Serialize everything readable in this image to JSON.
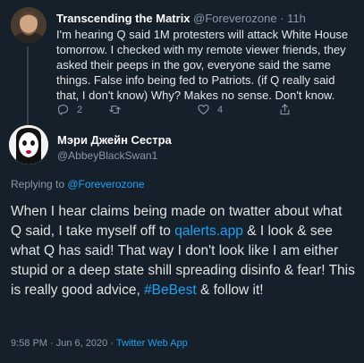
{
  "reply": {
    "author_name": "Transcending the Matrix",
    "handle": "@Foreverozone",
    "separator": "·",
    "time": "11h",
    "text": "I'm hearing Q said 1M protesters will attack White House tomorrow. I checked with my remote viewer friends, they asked their peeps in the gov, everyone said the same things. False info being fed to Patriots. (if Q really said that, I don't know) Why? Makes no sense. Don't know.",
    "actions": {
      "reply_count": "2",
      "retweet_count": "",
      "like_count": "4"
    }
  },
  "main_tweet": {
    "author_name": "Мэри Джейн Сестра",
    "handle": "@AbbeyBlackSwan1",
    "replying_prefix": "Replying to ",
    "replying_handle": "@Foreverozone",
    "text_part1": "When I hear claims being made on twatter about what Q said, I take myself off to ",
    "link": "qalerts.app",
    "text_part2": " & I look & see what Q has said! That way I don't look like I am either stupid or a deep state shill spreading disinfo & fear! This is really good advice, ",
    "hashtag": "#BeBest",
    "text_part3": " & follow it!",
    "time": "9:58 PM",
    "separator": "·",
    "date": "Jun 6, 2020",
    "source_separator": "·",
    "source": "Twitter Web App"
  },
  "colors": {
    "background": "#15202b",
    "accent": "#1da1f2",
    "muted": "#8899a6"
  },
  "icons": {
    "reply": "reply-icon",
    "retweet": "retweet-icon",
    "like": "heart-icon",
    "share": "share-icon"
  }
}
